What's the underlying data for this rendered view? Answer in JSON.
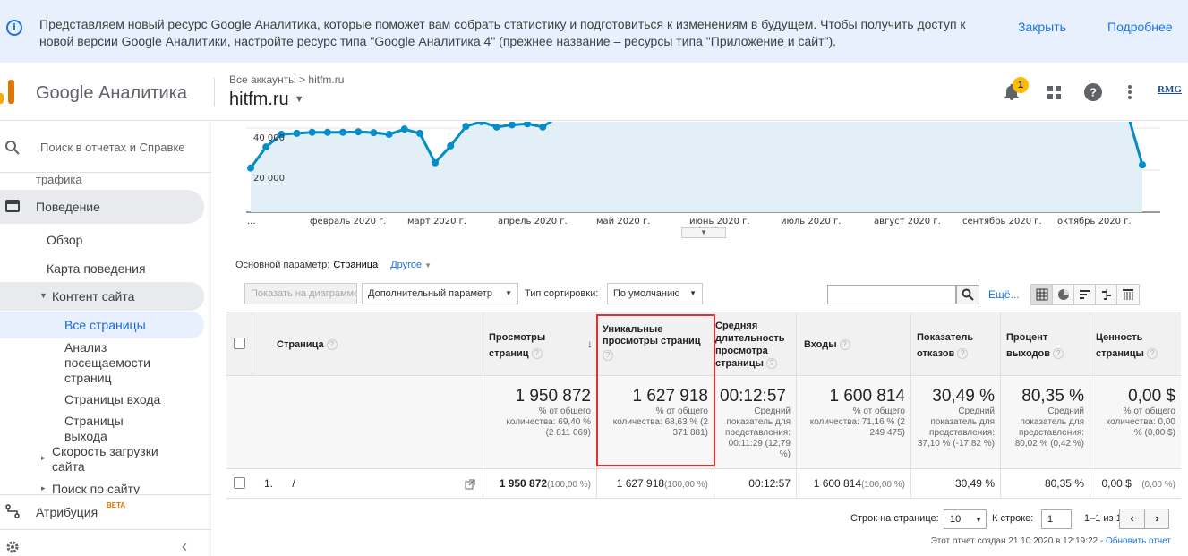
{
  "banner": {
    "message": "Представляем новый ресурс Google Аналитика, которые поможет вам собрать статистику и подготовиться к изменениям в будущем. Чтобы получить доступ к новой версии Google Аналитики, настройте ресурс типа \"Google Аналитика 4\" (прежнее название – ресурсы типа \"Приложение и сайт\").",
    "close_label": "Закрыть",
    "details_label": "Подробнее"
  },
  "header": {
    "brand": "Google Аналитика",
    "breadcrumb": "Все аккаунты > hitfm.ru",
    "property": "hitfm.ru",
    "notification_count": "1",
    "account_logo_text": "RMG"
  },
  "sidebar": {
    "search_placeholder": "Поиск в отчетах и Справке",
    "partial_item": "трафика",
    "behavior": "Поведение",
    "overview": "Обзор",
    "behavior_flow": "Карта поведения",
    "site_content": "Контент сайта",
    "all_pages": "Все страницы",
    "content_drilldown": "Анализ посещаемости страниц",
    "landing_pages": "Страницы входа",
    "exit_pages": "Страницы выхода",
    "site_speed": "Скорость загрузки сайта",
    "site_search": "Поиск по сайту",
    "attribution": "Атрибуция",
    "beta": "BETA"
  },
  "chart_data": {
    "type": "line",
    "color": "#058dc7",
    "y_ticks": [
      "40 000",
      "20 000"
    ],
    "x_labels": [
      "...",
      "февраль 2020 г.",
      "март 2020 г.",
      "апрель 2020 г.",
      "май 2020 г.",
      "июнь 2020 г.",
      "июль 2020 г.",
      "август 2020 г.",
      "сентябрь 2020 г.",
      "октябрь 2020 г."
    ],
    "ylim": [
      0,
      60000
    ],
    "values": [
      21000,
      31000,
      37000,
      37500,
      38000,
      38000,
      38000,
      38200,
      37800,
      37000,
      39500,
      37500,
      23500,
      31500,
      40800,
      43000,
      40500,
      41500,
      42000,
      40500,
      45500,
      47500,
      50000,
      51000,
      50500,
      52000,
      51500,
      51000,
      50500,
      51500,
      50500,
      50000,
      51000,
      50500,
      50500,
      50500,
      49500,
      50500,
      50000,
      49500,
      50000,
      50500,
      50500,
      50000,
      49500,
      49000,
      48500,
      48000,
      49000,
      48500,
      49000,
      49500,
      49000,
      48500,
      48000,
      47500,
      47500,
      48000,
      22500
    ]
  },
  "dimensions": {
    "label": "Основной параметр:",
    "current": "Страница",
    "other": "Другое"
  },
  "toolbar": {
    "plot_rows": "Показать на диаграмме",
    "secondary_dim": "Дополнительный параметр",
    "sort_label": "Тип сортировки:",
    "sort_value": "По умолчанию",
    "more": "Ещё..."
  },
  "table": {
    "headers": {
      "page": "Страница",
      "pageviews": "Просмотры страниц",
      "unique": "Уникальные просмотры страниц",
      "avg_time": "Средняя длительность просмотра страницы",
      "entrances": "Входы",
      "bounce": "Показатель отказов",
      "exit": "Процент выходов",
      "value": "Ценность страницы"
    },
    "totals": {
      "pageviews": "1 950 872",
      "pageviews_note": "% от общего количества: 69,40 % (2 811 069)",
      "unique": "1 627 918",
      "unique_note": "% от общего количества: 68,63 % (2 371 881)",
      "avg_time": "00:12:57",
      "avg_time_note": "Средний показатель для представления: 00:11:29 (12,79 %)",
      "entrances": "1 600 814",
      "entrances_note": "% от общего количества: 71,16 % (2 249 475)",
      "bounce": "30,49 %",
      "bounce_note": "Средний показатель для представления: 37,10 % (-17,82 %)",
      "exit": "80,35 %",
      "exit_note": "Средний показатель для представления: 80,02 % (0,42 %)",
      "value": "0,00 $",
      "value_note": "% от общего количества: 0,00 % (0,00 $)"
    },
    "rows": [
      {
        "index": "1.",
        "page": "/",
        "pageviews": "1 950 872",
        "pageviews_pct": "(100,00 %)",
        "unique": "1 627 918",
        "unique_pct": "(100,00 %)",
        "avg_time": "00:12:57",
        "entrances": "1 600 814",
        "entrances_pct": "(100,00 %)",
        "bounce": "30,49 %",
        "exit": "80,35 %",
        "value": "0,00 $",
        "value_pct": "(0,00 %)"
      }
    ]
  },
  "pagination": {
    "rows_label": "Строк на странице:",
    "rows_value": "10",
    "goto_label": "К строке:",
    "goto_value": "1",
    "range": "1–1 из 1"
  },
  "footer": {
    "created": "Этот отчет создан 21.10.2020 в 12:19:22 -",
    "refresh": "Обновить отчет"
  }
}
